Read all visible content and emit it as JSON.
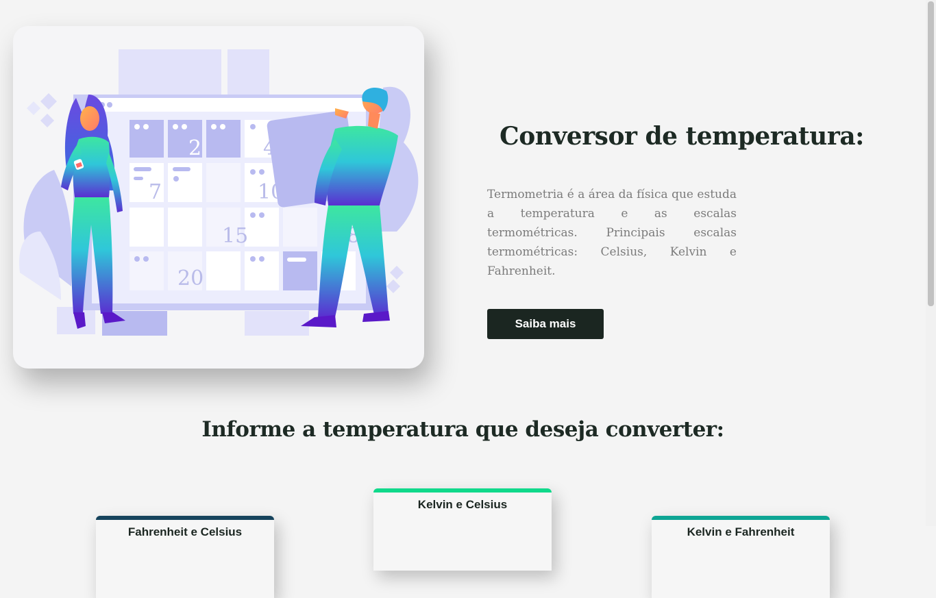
{
  "hero": {
    "title": "Conversor de temperatura:",
    "description": "Termometria é a área da física que estuda a temperatura e as escalas termométricas. Principais escalas termométricas: Celsius, Kelvin e Fahrenheit.",
    "button_label": "Saiba mais",
    "illustration": {
      "icon": "calendar-illustration",
      "calendar_numbers": [
        "2",
        "4",
        "7",
        "10",
        "15",
        "18",
        "20"
      ]
    }
  },
  "converter": {
    "title": "Informe a temperatura que deseja converter:",
    "cards": [
      {
        "label": "Fahrenheit e Celsius",
        "accent": "#16435c"
      },
      {
        "label": "Kelvin e Celsius",
        "accent": "#10d98b"
      },
      {
        "label": "Kelvin e Fahrenheit",
        "accent": "#0ea594"
      }
    ]
  },
  "colors": {
    "background": "#f4f4f4",
    "primary_dark": "#1b2621",
    "text_muted": "#7b7b7b"
  }
}
